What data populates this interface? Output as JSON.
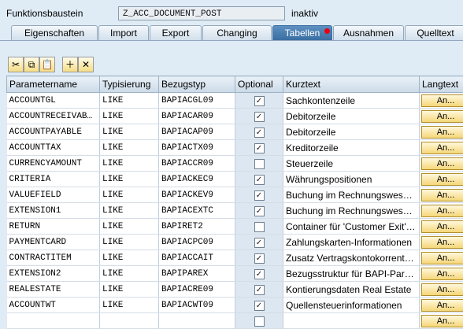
{
  "header": {
    "label": "Funktionsbaustein",
    "name": "Z_ACC_DOCUMENT_POST",
    "status": "inaktiv"
  },
  "tabs": [
    {
      "label": "Eigenschaften",
      "active": false
    },
    {
      "label": "Import",
      "active": false
    },
    {
      "label": "Export",
      "active": false
    },
    {
      "label": "Changing",
      "active": false
    },
    {
      "label": "Tabellen",
      "active": true
    },
    {
      "label": "Ausnahmen",
      "active": false
    },
    {
      "label": "Quelltext",
      "active": false
    }
  ],
  "toolbar": {
    "icons": [
      "cut-icon",
      "copy-icon",
      "paste-icon",
      "insert-row-icon",
      "delete-row-icon"
    ],
    "glyphs": [
      "✂",
      "⧉",
      "📋",
      "＋",
      "✕"
    ]
  },
  "columns": [
    "Parametername",
    "Typisierung",
    "Bezugstyp",
    "Optional",
    "Kurztext",
    "Langtext"
  ],
  "rows": [
    {
      "name": "ACCOUNTGL",
      "typ": "LIKE",
      "ref": "BAPIACGL09",
      "optional": true,
      "kurz": "Sachkontenzeile",
      "lang": "An..."
    },
    {
      "name": "ACCOUNTRECEIVAB…",
      "typ": "LIKE",
      "ref": "BAPIACAR09",
      "optional": true,
      "kurz": "Debitorzeile",
      "lang": "An..."
    },
    {
      "name": "ACCOUNTPAYABLE",
      "typ": "LIKE",
      "ref": "BAPIACAP09",
      "optional": true,
      "kurz": "Debitorzeile",
      "lang": "An..."
    },
    {
      "name": "ACCOUNTTAX",
      "typ": "LIKE",
      "ref": "BAPIACTX09",
      "optional": true,
      "kurz": "Kreditorzeile",
      "lang": "An..."
    },
    {
      "name": "CURRENCYAMOUNT",
      "typ": "LIKE",
      "ref": "BAPIACCR09",
      "optional": false,
      "kurz": "Steuerzeile",
      "lang": "An..."
    },
    {
      "name": "CRITERIA",
      "typ": "LIKE",
      "ref": "BAPIACKEC9",
      "optional": true,
      "kurz": "Währungspositionen",
      "lang": "An..."
    },
    {
      "name": "VALUEFIELD",
      "typ": "LIKE",
      "ref": "BAPIACKEV9",
      "optional": true,
      "kurz": "Buchung im Rechnungswesen…",
      "lang": "An..."
    },
    {
      "name": "EXTENSION1",
      "typ": "LIKE",
      "ref": "BAPIACEXTC",
      "optional": true,
      "kurz": "Buchung im Rechnungswesen…",
      "lang": "An..."
    },
    {
      "name": "RETURN",
      "typ": "LIKE",
      "ref": "BAPIRET2",
      "optional": false,
      "kurz": "Container für 'Customer Exit'-…",
      "lang": "An..."
    },
    {
      "name": "PAYMENTCARD",
      "typ": "LIKE",
      "ref": "BAPIACPC09",
      "optional": true,
      "kurz": "Zahlungskarten-Informationen",
      "lang": "An..."
    },
    {
      "name": "CONTRACTITEM",
      "typ": "LIKE",
      "ref": "BAPIACCAIT",
      "optional": true,
      "kurz": "Zusatz Vertragskontokorrent …",
      "lang": "An..."
    },
    {
      "name": "EXTENSION2",
      "typ": "LIKE",
      "ref": "BAPIPAREX",
      "optional": true,
      "kurz": "Bezugsstruktur für BAPI-Para…",
      "lang": "An..."
    },
    {
      "name": "REALESTATE",
      "typ": "LIKE",
      "ref": "BAPIACRE09",
      "optional": true,
      "kurz": "Kontierungsdaten Real Estate",
      "lang": "An..."
    },
    {
      "name": "ACCOUNTWT",
      "typ": "LIKE",
      "ref": "BAPIACWT09",
      "optional": true,
      "kurz": "Quellensteuerinformationen",
      "lang": "An..."
    },
    {
      "name": "",
      "typ": "",
      "ref": "",
      "optional": false,
      "kurz": "",
      "lang": "An..."
    }
  ],
  "check_glyph": "✓"
}
